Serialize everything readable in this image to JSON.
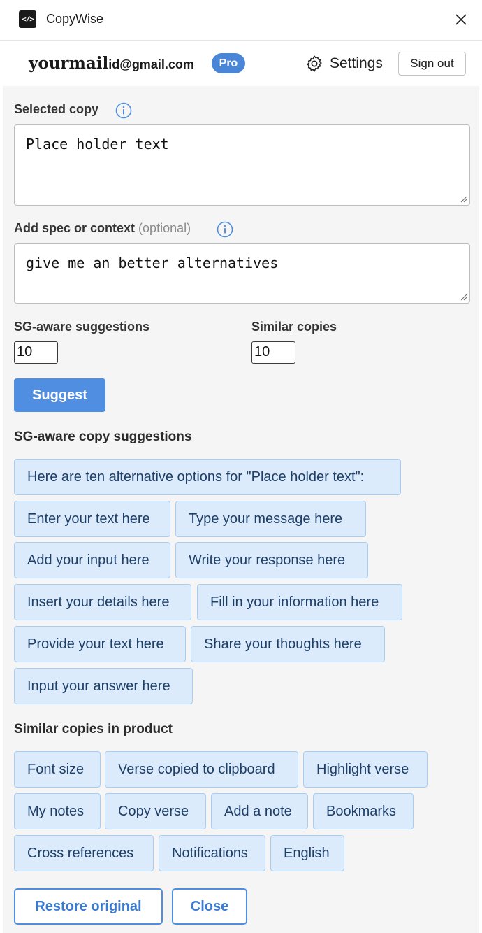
{
  "titlebar": {
    "logo_text": "</>",
    "title": "CopyWise",
    "close_glyph": "✕"
  },
  "account": {
    "email_prefix": "yourmail",
    "email_suffix": "id@gmail.com",
    "plan_badge": "Pro",
    "settings_label": "Settings",
    "signout_label": "Sign out"
  },
  "selected_copy": {
    "label": "Selected copy",
    "value": "Place holder text"
  },
  "context": {
    "label": "Add spec or context",
    "optional_hint": "(optional)",
    "value": "give me an better alternatives"
  },
  "counts": {
    "sg_label": "SG-aware suggestions",
    "sg_value": "10",
    "similar_label": "Similar copies",
    "similar_value": "10"
  },
  "suggest_button": "Suggest",
  "suggestions": {
    "title": "SG-aware copy suggestions",
    "items": [
      "Here are ten alternative options for \"Place holder text\":",
      "Enter your text here",
      "Type your message here",
      "Add your input here",
      "Write your response here",
      "Insert your details here",
      "Fill in your information here",
      "Provide your text here",
      "Share your thoughts here",
      "Input your answer here"
    ]
  },
  "similar": {
    "title": "Similar copies in product",
    "items": [
      "Font size",
      "Verse copied to clipboard",
      "Highlight verse",
      "My notes",
      "Copy verse",
      "Add a note",
      "Bookmarks",
      "Cross references",
      "Notifications",
      "English"
    ]
  },
  "footer": {
    "restore_label": "Restore original",
    "close_label": "Close"
  },
  "colors": {
    "accent": "#4f8ee0",
    "chip_bg": "#dcebfb",
    "chip_border": "#a8cdf3",
    "chip_text": "#1d3f68",
    "panel_bg": "#f5f5f5"
  }
}
